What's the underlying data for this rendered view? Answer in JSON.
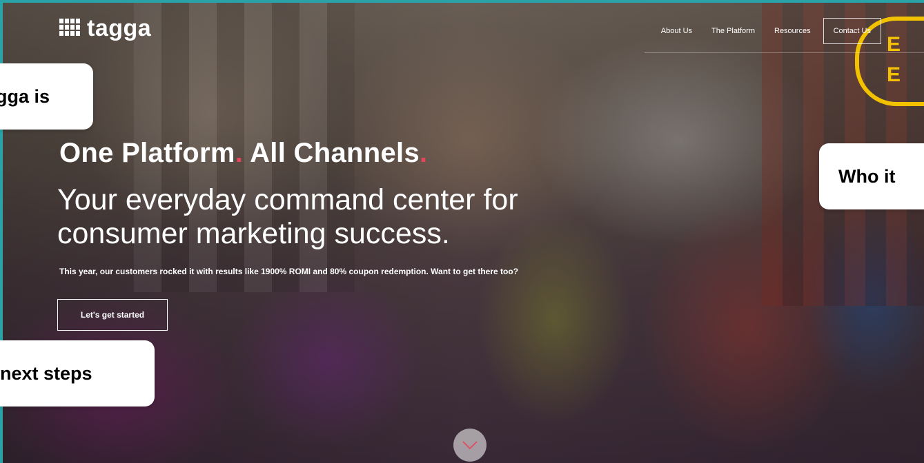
{
  "header": {
    "logo_text": "tagga",
    "nav": [
      {
        "label": "About Us"
      },
      {
        "label": "The Platform"
      },
      {
        "label": "Resources"
      },
      {
        "label": "Contact Us"
      }
    ]
  },
  "hero": {
    "title": "One Platform",
    "title_part2": "All Channels",
    "punctuation": ".",
    "subtitle": "Your everyday command center for consumer marketing success.",
    "description": "This year, our customers rocked it with results like 1900% ROMI and 80% coupon redemption. Want to get there too?",
    "cta_label": "Let's get started"
  },
  "callouts": {
    "left_top": "gga is",
    "right": "Who it",
    "left_bottom": "next steps"
  },
  "background_sign": {
    "ee_letters": [
      "E",
      "E"
    ]
  },
  "icons": {
    "logo": "grid-dots-icon",
    "scroll": "chevron-down-icon"
  },
  "colors": {
    "accent_dot": "#e6455c",
    "frame_border": "#2aa3a8",
    "ee_yellow": "#f2c200"
  }
}
